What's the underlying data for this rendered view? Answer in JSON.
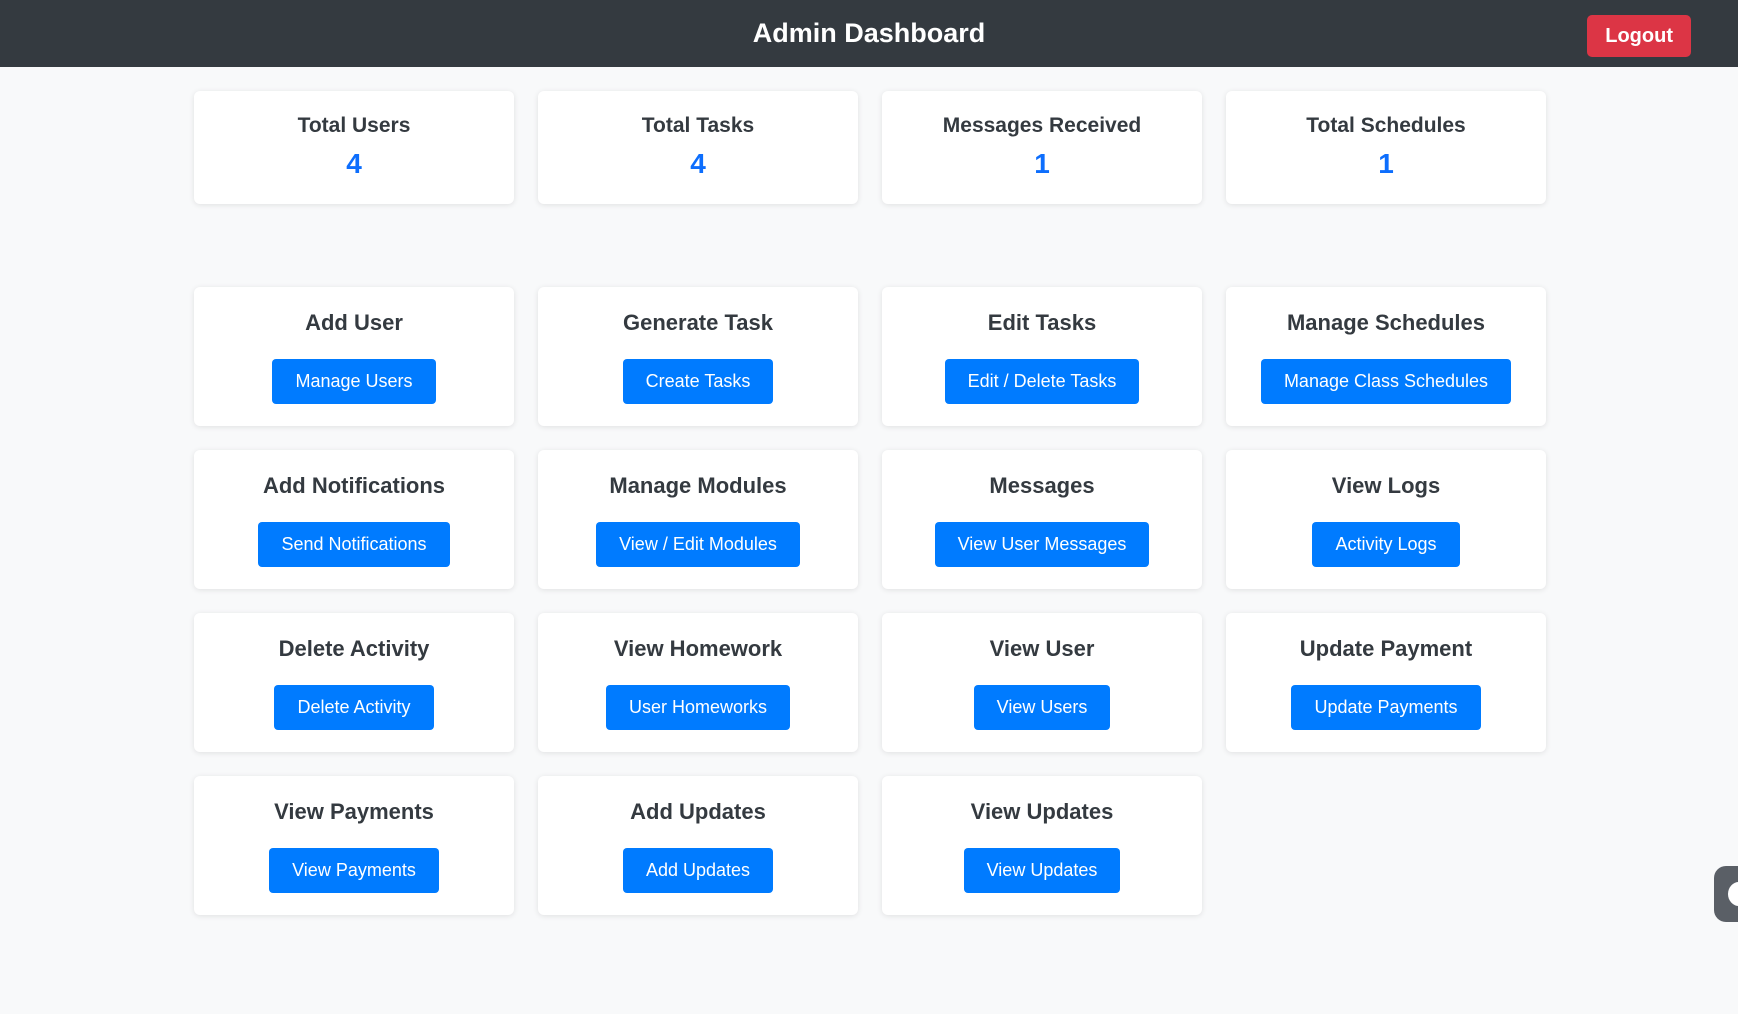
{
  "header": {
    "title": "Admin Dashboard",
    "logout_label": "Logout"
  },
  "stats": [
    {
      "label": "Total Users",
      "value": "4"
    },
    {
      "label": "Total Tasks",
      "value": "4"
    },
    {
      "label": "Messages Received",
      "value": "1"
    },
    {
      "label": "Total Schedules",
      "value": "1"
    }
  ],
  "actions": [
    {
      "title": "Add User",
      "button": "Manage Users"
    },
    {
      "title": "Generate Task",
      "button": "Create Tasks"
    },
    {
      "title": "Edit Tasks",
      "button": "Edit / Delete Tasks"
    },
    {
      "title": "Manage Schedules",
      "button": "Manage Class Schedules"
    },
    {
      "title": "Add Notifications",
      "button": "Send Notifications"
    },
    {
      "title": "Manage Modules",
      "button": "View / Edit Modules"
    },
    {
      "title": "Messages",
      "button": "View User Messages"
    },
    {
      "title": "View Logs",
      "button": "Activity Logs"
    },
    {
      "title": "Delete Activity",
      "button": "Delete Activity"
    },
    {
      "title": "View Homework",
      "button": "User Homeworks"
    },
    {
      "title": "View User",
      "button": "View Users"
    },
    {
      "title": "Update Payment",
      "button": "Update Payments"
    },
    {
      "title": "View Payments",
      "button": "View Payments"
    },
    {
      "title": "Add Updates",
      "button": "Add Updates"
    },
    {
      "title": "View Updates",
      "button": "View Updates"
    }
  ],
  "colors": {
    "header_bg": "#343a40",
    "primary": "#007bff",
    "danger": "#dc3545",
    "stat_value": "#0d6efd"
  }
}
